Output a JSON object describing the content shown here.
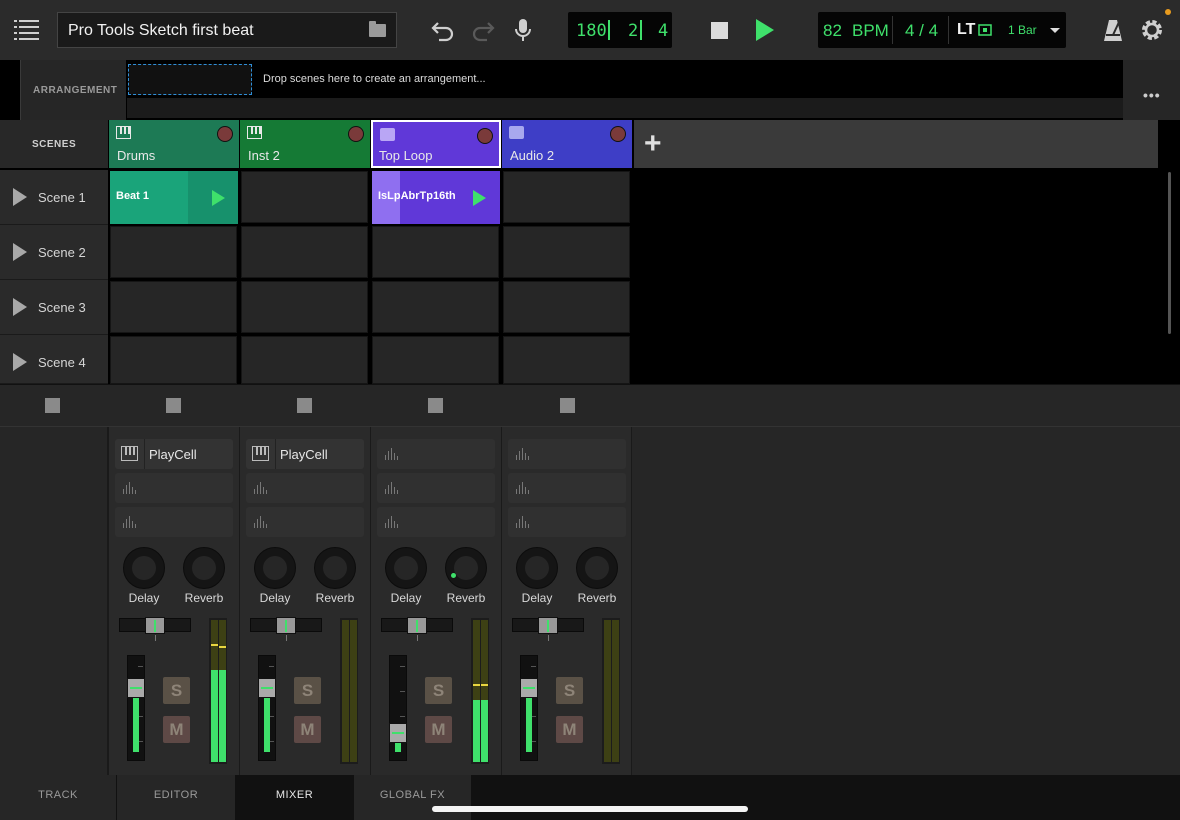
{
  "header": {
    "project_title": "Pro Tools Sketch first beat",
    "counter": {
      "bars": "180",
      "beats": "2",
      "sub": "4"
    },
    "tempo": {
      "bpm_value": "82",
      "bpm_unit": "BPM",
      "signature": "4 / 4",
      "lt_label": "LT",
      "bar_label": "1 Bar"
    }
  },
  "arrangement": {
    "label": "ARRANGEMENT",
    "hint": "Drop scenes here to create an arrangement..."
  },
  "scenes": {
    "header": "SCENES",
    "rows": [
      {
        "label": "Scene 1"
      },
      {
        "label": "Scene 2"
      },
      {
        "label": "Scene 3"
      },
      {
        "label": "Scene 4"
      }
    ]
  },
  "tracks": [
    {
      "name": "Drums",
      "icon": "piano-icon",
      "color": "#1d7a55"
    },
    {
      "name": "Inst 2",
      "icon": "piano-icon",
      "color": "#157a35"
    },
    {
      "name": "Top Loop",
      "icon": "waveform-icon",
      "color": "#6038d8"
    },
    {
      "name": "Audio 2",
      "icon": "waveform-icon",
      "color": "#3e3ec6"
    }
  ],
  "clips": {
    "beat": {
      "label": "Beat 1",
      "color": "#1aa47a"
    },
    "loop": {
      "label": "IsLpAbrTp16th",
      "color": "#6038d8"
    }
  },
  "mixer": {
    "strips": [
      {
        "slot1": "PlayCell",
        "knob1": "Delay",
        "knob2": "Reverb",
        "solo": "S",
        "mute": "M"
      },
      {
        "slot1": "PlayCell",
        "knob1": "Delay",
        "knob2": "Reverb",
        "solo": "S",
        "mute": "M"
      },
      {
        "slot1": "",
        "knob1": "Delay",
        "knob2": "Reverb",
        "solo": "S",
        "mute": "M"
      },
      {
        "slot1": "",
        "knob1": "Delay",
        "knob2": "Reverb",
        "solo": "S",
        "mute": "M"
      }
    ]
  },
  "tabs": [
    {
      "label": "TRACK"
    },
    {
      "label": "EDITOR"
    },
    {
      "label": "MIXER"
    },
    {
      "label": "GLOBAL FX"
    }
  ],
  "colors": {
    "accent": "#3fe06b",
    "record": "#7a3a3a",
    "notification": "#e89b1e"
  }
}
